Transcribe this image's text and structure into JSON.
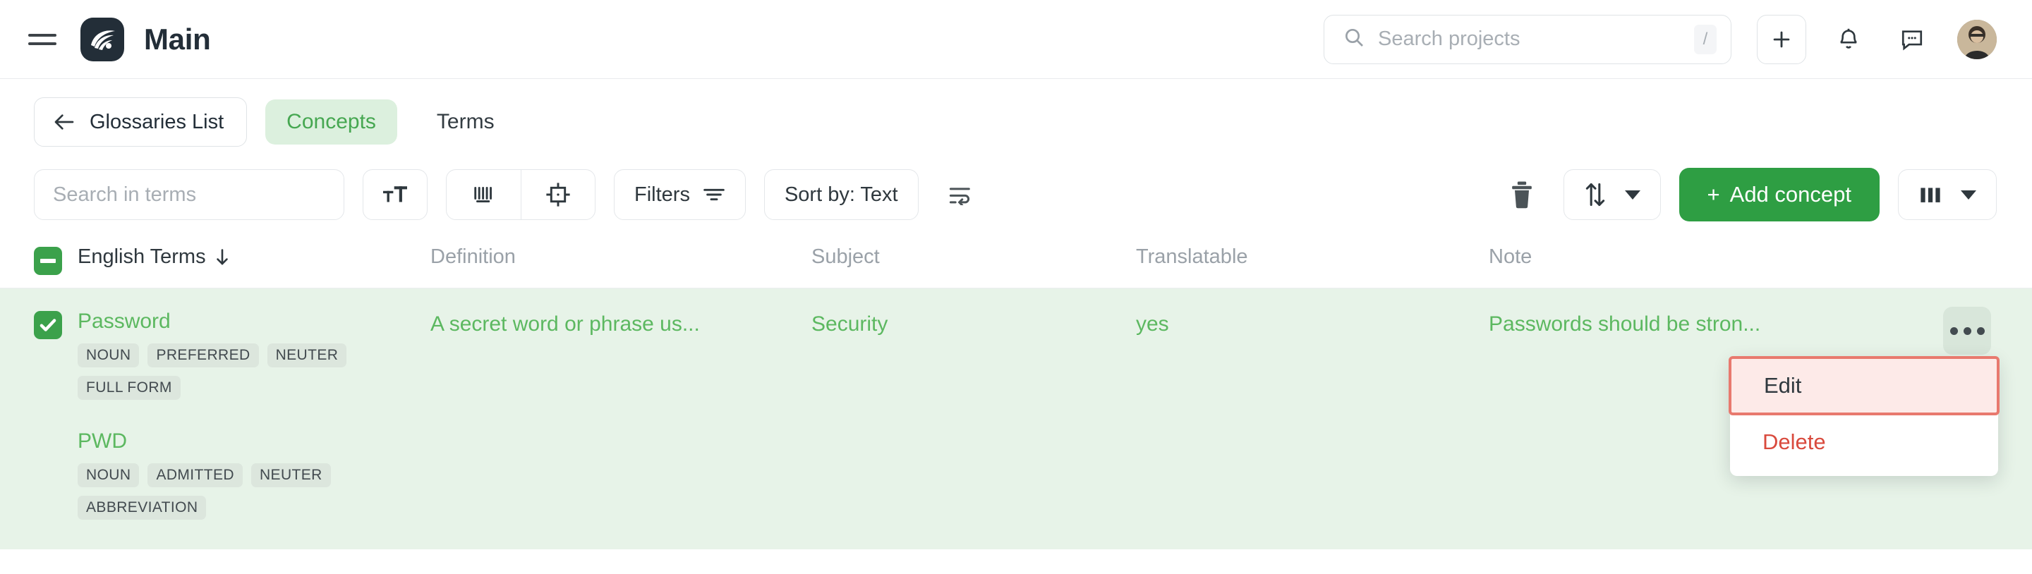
{
  "header": {
    "menu_icon": "hamburger-icon",
    "logo_icon": "app-logo-icon",
    "title": "Main",
    "search": {
      "placeholder": "Search projects",
      "value": "",
      "icon": "search-icon",
      "shortcut": "/"
    },
    "add_icon": "plus-icon",
    "notifications_icon": "bell-icon",
    "messages_icon": "chat-icon",
    "avatar_icon": "user-avatar"
  },
  "nav": {
    "back_label": "Glossaries List",
    "back_icon": "arrow-left-icon",
    "tabs": [
      {
        "label": "Concepts",
        "active": true
      },
      {
        "label": "Terms",
        "active": false
      }
    ]
  },
  "toolbar": {
    "search_placeholder": "Search in terms",
    "search_value": "",
    "text_size_icon": "text-size-icon",
    "barcode_icon": "barcode-icon",
    "crosshair_icon": "crosshair-frame-icon",
    "filters_label": "Filters",
    "filters_icon": "filter-icon",
    "sort_label": "Sort by: Text",
    "wrap_icon": "text-wrap-icon",
    "delete_icon": "trash-icon",
    "transfer_icon": "sort-updown-icon",
    "add_concept_label": "Add concept",
    "add_concept_plus": "+",
    "columns_icon": "columns-icon",
    "accent_color": "#2e9e43"
  },
  "table": {
    "columns": [
      {
        "label": "English Terms",
        "sorted": true,
        "sort_icon": "arrow-down-icon"
      },
      {
        "label": "Definition",
        "sorted": false
      },
      {
        "label": "Subject",
        "sorted": false
      },
      {
        "label": "Translatable",
        "sorted": false
      },
      {
        "label": "Note",
        "sorted": false
      }
    ],
    "select_all_state": "indeterminate",
    "rows": [
      {
        "selected": true,
        "terms": [
          {
            "name": "Password",
            "tags": [
              "NOUN",
              "PREFERRED",
              "NEUTER",
              "FULL FORM"
            ]
          },
          {
            "name": "PWD",
            "tags": [
              "NOUN",
              "ADMITTED",
              "NEUTER",
              "ABBREVIATION"
            ]
          }
        ],
        "definition": "A secret word or phrase us...",
        "subject": "Security",
        "translatable": "yes",
        "note": "Passwords should be stron...",
        "actions_icon": "ellipsis-icon"
      }
    ]
  },
  "context_menu": {
    "open": true,
    "items": [
      {
        "label": "Edit",
        "highlighted": true,
        "danger": false
      },
      {
        "label": "Delete",
        "highlighted": false,
        "danger": true
      }
    ],
    "highlight_border_color": "#e8796e",
    "highlight_fill_color": "#fdeae8",
    "danger_color": "#d94a3d"
  }
}
